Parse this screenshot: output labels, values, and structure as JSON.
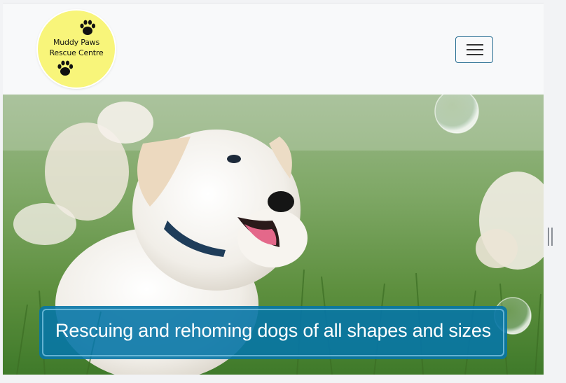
{
  "brand": {
    "logo_line1": "Muddy Paws",
    "logo_line2": "Rescue Centre",
    "logo_color": "#f8f57a"
  },
  "navbar": {
    "toggler_icon": "hamburger-menu-icon",
    "border_color": "#2a6f93"
  },
  "hero": {
    "image": "white puppies running in grass with bubbles",
    "banner_text": "Rescuing and rehoming dogs of all shapes and sizes",
    "banner_color": "#0775a6"
  }
}
